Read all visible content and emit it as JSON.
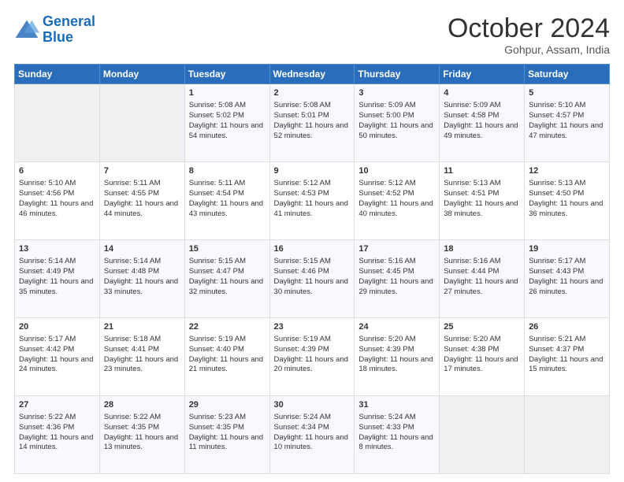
{
  "header": {
    "logo_line1": "General",
    "logo_line2": "Blue",
    "month": "October 2024",
    "location": "Gohpur, Assam, India"
  },
  "weekdays": [
    "Sunday",
    "Monday",
    "Tuesday",
    "Wednesday",
    "Thursday",
    "Friday",
    "Saturday"
  ],
  "weeks": [
    [
      {
        "day": "",
        "empty": true
      },
      {
        "day": "",
        "empty": true
      },
      {
        "day": "1",
        "sunrise": "5:08 AM",
        "sunset": "5:02 PM",
        "daylight": "11 hours and 54 minutes."
      },
      {
        "day": "2",
        "sunrise": "5:08 AM",
        "sunset": "5:01 PM",
        "daylight": "11 hours and 52 minutes."
      },
      {
        "day": "3",
        "sunrise": "5:09 AM",
        "sunset": "5:00 PM",
        "daylight": "11 hours and 50 minutes."
      },
      {
        "day": "4",
        "sunrise": "5:09 AM",
        "sunset": "4:58 PM",
        "daylight": "11 hours and 49 minutes."
      },
      {
        "day": "5",
        "sunrise": "5:10 AM",
        "sunset": "4:57 PM",
        "daylight": "11 hours and 47 minutes."
      }
    ],
    [
      {
        "day": "6",
        "sunrise": "5:10 AM",
        "sunset": "4:56 PM",
        "daylight": "11 hours and 46 minutes."
      },
      {
        "day": "7",
        "sunrise": "5:11 AM",
        "sunset": "4:55 PM",
        "daylight": "11 hours and 44 minutes."
      },
      {
        "day": "8",
        "sunrise": "5:11 AM",
        "sunset": "4:54 PM",
        "daylight": "11 hours and 43 minutes."
      },
      {
        "day": "9",
        "sunrise": "5:12 AM",
        "sunset": "4:53 PM",
        "daylight": "11 hours and 41 minutes."
      },
      {
        "day": "10",
        "sunrise": "5:12 AM",
        "sunset": "4:52 PM",
        "daylight": "11 hours and 40 minutes."
      },
      {
        "day": "11",
        "sunrise": "5:13 AM",
        "sunset": "4:51 PM",
        "daylight": "11 hours and 38 minutes."
      },
      {
        "day": "12",
        "sunrise": "5:13 AM",
        "sunset": "4:50 PM",
        "daylight": "11 hours and 36 minutes."
      }
    ],
    [
      {
        "day": "13",
        "sunrise": "5:14 AM",
        "sunset": "4:49 PM",
        "daylight": "11 hours and 35 minutes."
      },
      {
        "day": "14",
        "sunrise": "5:14 AM",
        "sunset": "4:48 PM",
        "daylight": "11 hours and 33 minutes."
      },
      {
        "day": "15",
        "sunrise": "5:15 AM",
        "sunset": "4:47 PM",
        "daylight": "11 hours and 32 minutes."
      },
      {
        "day": "16",
        "sunrise": "5:15 AM",
        "sunset": "4:46 PM",
        "daylight": "11 hours and 30 minutes."
      },
      {
        "day": "17",
        "sunrise": "5:16 AM",
        "sunset": "4:45 PM",
        "daylight": "11 hours and 29 minutes."
      },
      {
        "day": "18",
        "sunrise": "5:16 AM",
        "sunset": "4:44 PM",
        "daylight": "11 hours and 27 minutes."
      },
      {
        "day": "19",
        "sunrise": "5:17 AM",
        "sunset": "4:43 PM",
        "daylight": "11 hours and 26 minutes."
      }
    ],
    [
      {
        "day": "20",
        "sunrise": "5:17 AM",
        "sunset": "4:42 PM",
        "daylight": "11 hours and 24 minutes."
      },
      {
        "day": "21",
        "sunrise": "5:18 AM",
        "sunset": "4:41 PM",
        "daylight": "11 hours and 23 minutes."
      },
      {
        "day": "22",
        "sunrise": "5:19 AM",
        "sunset": "4:40 PM",
        "daylight": "11 hours and 21 minutes."
      },
      {
        "day": "23",
        "sunrise": "5:19 AM",
        "sunset": "4:39 PM",
        "daylight": "11 hours and 20 minutes."
      },
      {
        "day": "24",
        "sunrise": "5:20 AM",
        "sunset": "4:39 PM",
        "daylight": "11 hours and 18 minutes."
      },
      {
        "day": "25",
        "sunrise": "5:20 AM",
        "sunset": "4:38 PM",
        "daylight": "11 hours and 17 minutes."
      },
      {
        "day": "26",
        "sunrise": "5:21 AM",
        "sunset": "4:37 PM",
        "daylight": "11 hours and 15 minutes."
      }
    ],
    [
      {
        "day": "27",
        "sunrise": "5:22 AM",
        "sunset": "4:36 PM",
        "daylight": "11 hours and 14 minutes."
      },
      {
        "day": "28",
        "sunrise": "5:22 AM",
        "sunset": "4:35 PM",
        "daylight": "11 hours and 13 minutes."
      },
      {
        "day": "29",
        "sunrise": "5:23 AM",
        "sunset": "4:35 PM",
        "daylight": "11 hours and 11 minutes."
      },
      {
        "day": "30",
        "sunrise": "5:24 AM",
        "sunset": "4:34 PM",
        "daylight": "11 hours and 10 minutes."
      },
      {
        "day": "31",
        "sunrise": "5:24 AM",
        "sunset": "4:33 PM",
        "daylight": "11 hours and 8 minutes."
      },
      {
        "day": "",
        "empty": true
      },
      {
        "day": "",
        "empty": true
      }
    ]
  ]
}
